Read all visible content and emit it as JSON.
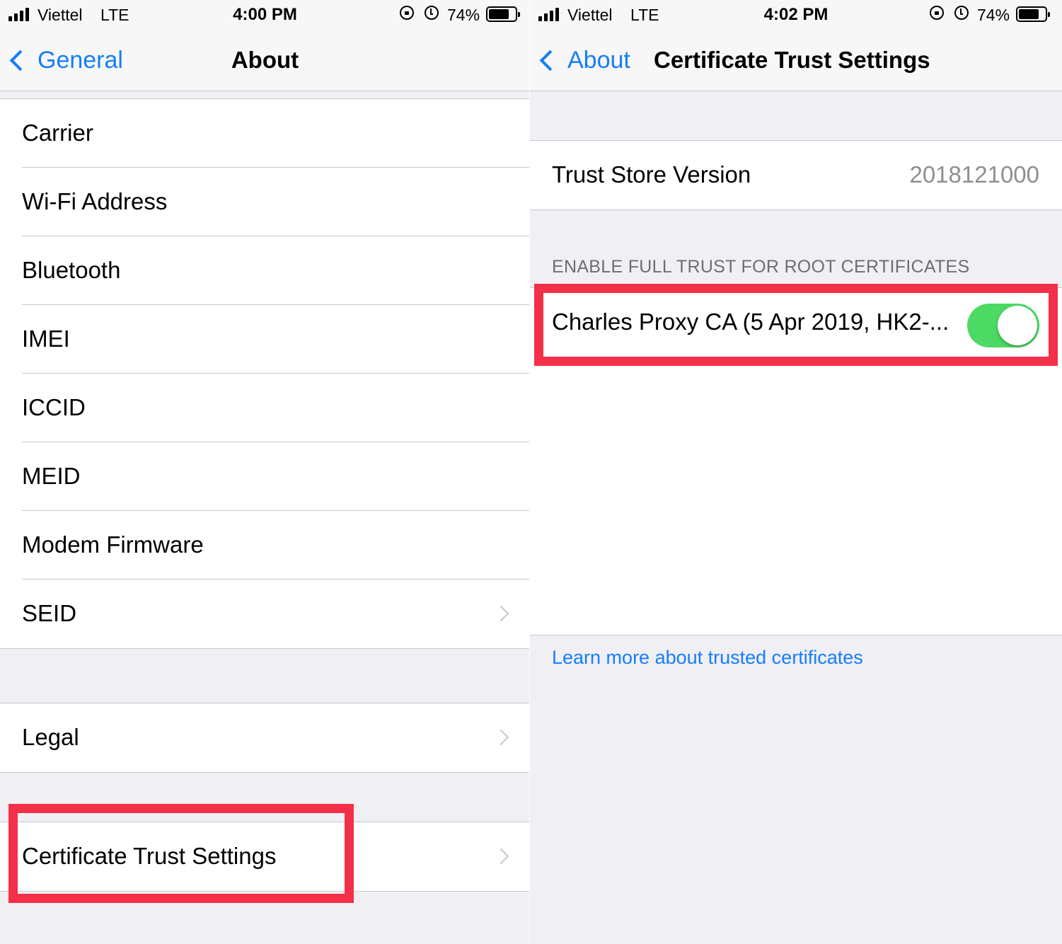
{
  "left": {
    "status": {
      "carrier": "Viettel",
      "network": "LTE",
      "time": "4:00 PM",
      "battery": "74%"
    },
    "nav": {
      "back_label": "General",
      "title": "About"
    },
    "rows": [
      {
        "label": "Carrier"
      },
      {
        "label": "Wi-Fi Address"
      },
      {
        "label": "Bluetooth"
      },
      {
        "label": "IMEI"
      },
      {
        "label": "ICCID"
      },
      {
        "label": "MEID"
      },
      {
        "label": "Modem Firmware"
      },
      {
        "label": "SEID"
      }
    ],
    "legal": {
      "label": "Legal"
    },
    "cert": {
      "label": "Certificate Trust Settings"
    }
  },
  "right": {
    "status": {
      "carrier": "Viettel",
      "network": "LTE",
      "time": "4:02 PM",
      "battery": "74%"
    },
    "nav": {
      "back_label": "About",
      "title": "Certificate Trust Settings"
    },
    "trust_store": {
      "label": "Trust Store Version",
      "value": "2018121000"
    },
    "section_header": "ENABLE FULL TRUST FOR ROOT CERTIFICATES",
    "certificate": {
      "label": "Charles Proxy CA (5 Apr 2019, HK2-...",
      "enabled": true
    },
    "footer_link": "Learn more about trusted certificates"
  },
  "colors": {
    "accent": "#157efb",
    "toggle_on": "#4cd964",
    "highlight": "#f42f48",
    "background": "#efeff4"
  },
  "icons": [
    "signal-icon",
    "orientation-lock-icon",
    "alarm-icon",
    "battery-icon",
    "chevron-left-icon",
    "chevron-right-icon"
  ]
}
